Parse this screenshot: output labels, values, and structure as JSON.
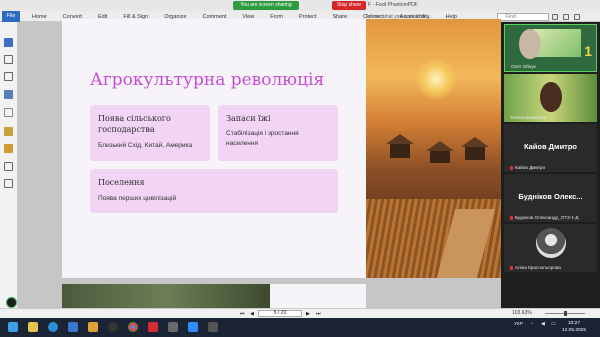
{
  "titlebar": {
    "sharing_text": "You are screen sharing",
    "stop_share": "Stop share",
    "app_title": "F - Foxit PhantomPDF"
  },
  "ribbon": {
    "file_tab": "File",
    "menu": [
      "Home",
      "Convert",
      "Edit",
      "Fill & Sign",
      "Organize",
      "Comment",
      "View",
      "Form",
      "Protect",
      "Share",
      "Connect",
      "Accessibility",
      "Help"
    ],
    "tell_me": "Tell me what you want to do...",
    "find_placeholder": "Find"
  },
  "slide": {
    "title": "Агрокультурна революція",
    "cards": [
      {
        "title": "Поява сільського господарства",
        "text": "Близький Схід, Китай, Америка"
      },
      {
        "title": "Запаси їжі",
        "text": "Стабілізація і зростання населення"
      },
      {
        "title": "Поселення",
        "text": "Поява перших цивілізацій"
      }
    ]
  },
  "participants": [
    {
      "name": "Олег Обнук",
      "type": "video",
      "badge": "1"
    },
    {
      "name": "Тетяна Бокорова",
      "type": "video"
    },
    {
      "name": "Кайов Дмитро",
      "big_name": "Кайов Дмитро",
      "type": "name"
    },
    {
      "name": "Будніков Олександр_ОТЗ-1-Д",
      "big_name": "Будніков Олекс...",
      "type": "name"
    },
    {
      "name": "Аліна Краснопьорова",
      "type": "photo"
    }
  ],
  "statusbar": {
    "page_indicator": "5 / 20",
    "zoom": "103.63%"
  },
  "taskbar": {
    "language": "УКР",
    "time": "10:27",
    "date": "12.05.2025"
  },
  "colors": {
    "title_accent": "#c64bd6",
    "card_bg": "#f2d4f4",
    "share_green": "#2e9c3e",
    "stop_red": "#d52727"
  }
}
